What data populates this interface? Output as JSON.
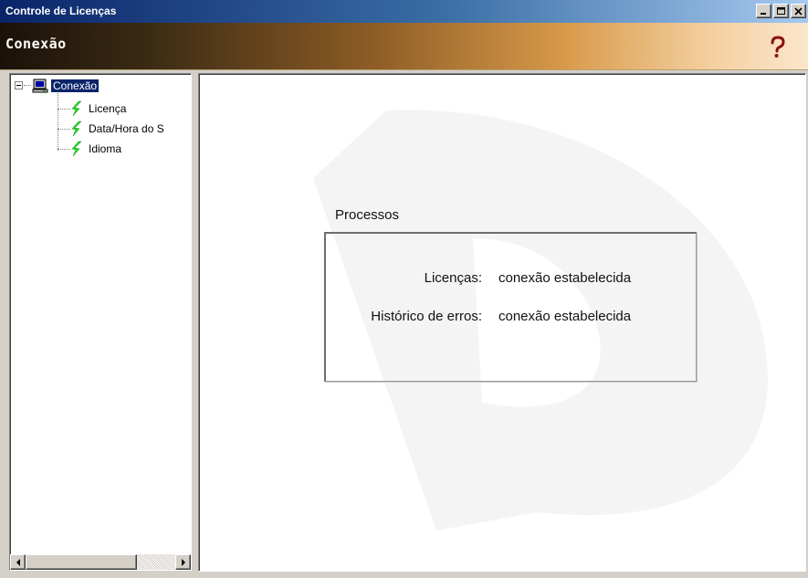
{
  "window": {
    "title": "Controle de Licenças",
    "buttons": [
      "minimize",
      "maximize",
      "close"
    ]
  },
  "header": {
    "title": "Conexão",
    "help_icon": "help-question-icon"
  },
  "tree": {
    "root": {
      "label": "Conexão",
      "icon": "computer-icon",
      "expanded": true,
      "selected": true
    },
    "children": [
      {
        "label": "Licença",
        "icon": "lightning-icon"
      },
      {
        "label": "Data/Hora do S",
        "icon": "lightning-icon"
      },
      {
        "label": "Idioma",
        "icon": "lightning-icon"
      }
    ]
  },
  "processes": {
    "title": "Processos",
    "rows": [
      {
        "label": "Licenças:",
        "status": "conexão estabelecida"
      },
      {
        "label": "Histórico de erros:",
        "status": "conexão estabelecida"
      }
    ]
  },
  "colors": {
    "titlebar": "#0a246a",
    "selection": "#0a246a",
    "lightning": "#22dd22",
    "help": "#8b1010"
  }
}
